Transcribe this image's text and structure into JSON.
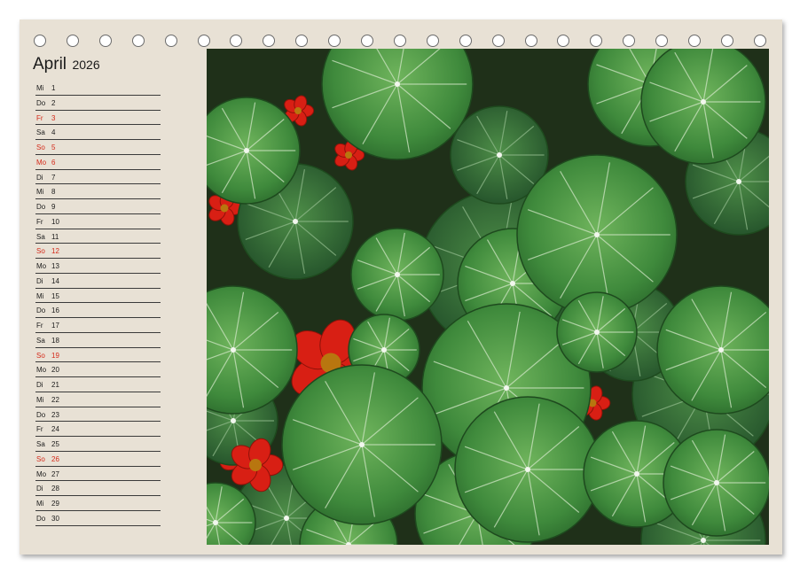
{
  "calendar": {
    "month": "April",
    "year": "2026",
    "days": [
      {
        "wd": "Mi",
        "d": "1",
        "red": false
      },
      {
        "wd": "Do",
        "d": "2",
        "red": false
      },
      {
        "wd": "Fr",
        "d": "3",
        "red": true
      },
      {
        "wd": "Sa",
        "d": "4",
        "red": false
      },
      {
        "wd": "So",
        "d": "5",
        "red": true
      },
      {
        "wd": "Mo",
        "d": "6",
        "red": true
      },
      {
        "wd": "Di",
        "d": "7",
        "red": false
      },
      {
        "wd": "Mi",
        "d": "8",
        "red": false
      },
      {
        "wd": "Do",
        "d": "9",
        "red": false
      },
      {
        "wd": "Fr",
        "d": "10",
        "red": false
      },
      {
        "wd": "Sa",
        "d": "11",
        "red": false
      },
      {
        "wd": "So",
        "d": "12",
        "red": true
      },
      {
        "wd": "Mo",
        "d": "13",
        "red": false
      },
      {
        "wd": "Di",
        "d": "14",
        "red": false
      },
      {
        "wd": "Mi",
        "d": "15",
        "red": false
      },
      {
        "wd": "Do",
        "d": "16",
        "red": false
      },
      {
        "wd": "Fr",
        "d": "17",
        "red": false
      },
      {
        "wd": "Sa",
        "d": "18",
        "red": false
      },
      {
        "wd": "So",
        "d": "19",
        "red": true
      },
      {
        "wd": "Mo",
        "d": "20",
        "red": false
      },
      {
        "wd": "Di",
        "d": "21",
        "red": false
      },
      {
        "wd": "Mi",
        "d": "22",
        "red": false
      },
      {
        "wd": "Do",
        "d": "23",
        "red": false
      },
      {
        "wd": "Fr",
        "d": "24",
        "red": false
      },
      {
        "wd": "Sa",
        "d": "25",
        "red": false
      },
      {
        "wd": "So",
        "d": "26",
        "red": true
      },
      {
        "wd": "Mo",
        "d": "27",
        "red": false
      },
      {
        "wd": "Di",
        "d": "28",
        "red": false
      },
      {
        "wd": "Mi",
        "d": "29",
        "red": false
      },
      {
        "wd": "Do",
        "d": "30",
        "red": false
      }
    ]
  },
  "colors": {
    "paper": "#e8e1d5",
    "holiday_red": "#d42a1a",
    "leaf_green": "#3f8a3c",
    "flower_red": "#d81f14"
  },
  "photo": {
    "icon": "nasturtium-photo"
  }
}
